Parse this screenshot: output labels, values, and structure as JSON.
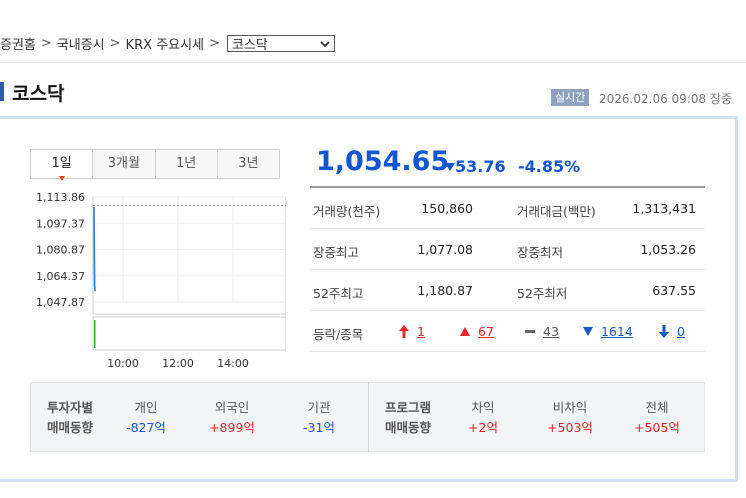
{
  "breadcrumb": {
    "home": "증권홈",
    "domestic": "국내증시",
    "krx": "KRX 주요시세",
    "selected": "코스닥"
  },
  "page": {
    "title": "코스닥",
    "realtime_badge": "실시간",
    "timestamp": "2026.02.06 09:08 장중"
  },
  "tabs": [
    "1일",
    "3개월",
    "1년",
    "3년"
  ],
  "chart_data": {
    "type": "line",
    "yticks": [
      "1,113.86",
      "1,097.37",
      "1,080.87",
      "1,064.37",
      "1,047.87"
    ],
    "ylim": [
      1047.87,
      1113.86
    ],
    "xticks": [
      "10:00",
      "12:00",
      "14:00"
    ],
    "prev_close": 1108.41,
    "series": [
      {
        "values": [
          1107.5,
          1058.0,
          1054.65
        ]
      }
    ],
    "volume": [
      1
    ]
  },
  "quote": {
    "value": "1,054.65",
    "change": "53.76",
    "change_pct": "-4.85%",
    "color": "#1256d4"
  },
  "stats": {
    "volume_label": "거래량(천주)",
    "volume": "150,860",
    "amount_label": "거래대금(백만)",
    "amount": "1,313,431",
    "high_label": "장중최고",
    "high": "1,077.08",
    "low_label": "장중최저",
    "low": "1,053.26",
    "high52_label": "52주최고",
    "high52": "1,180.87",
    "low52_label": "52주최저",
    "low52": "637.55",
    "advdec_label": "등락/종목",
    "upper_limit": "1",
    "up": "67",
    "flat": "43",
    "down": "1614",
    "lower_limit": "0"
  },
  "investors": {
    "head1": "투자자별",
    "head2": "매매동향",
    "individual_label": "개인",
    "individual": "-827억",
    "foreign_label": "외국인",
    "foreign": "+899억",
    "institution_label": "기관",
    "institution": "-31억"
  },
  "program": {
    "head1": "프로그램",
    "head2": "매매동향",
    "arb_label": "차익",
    "arb": "+2억",
    "nonarb_label": "비차익",
    "nonarb": "+503억",
    "total_label": "전체",
    "total": "+505억"
  }
}
